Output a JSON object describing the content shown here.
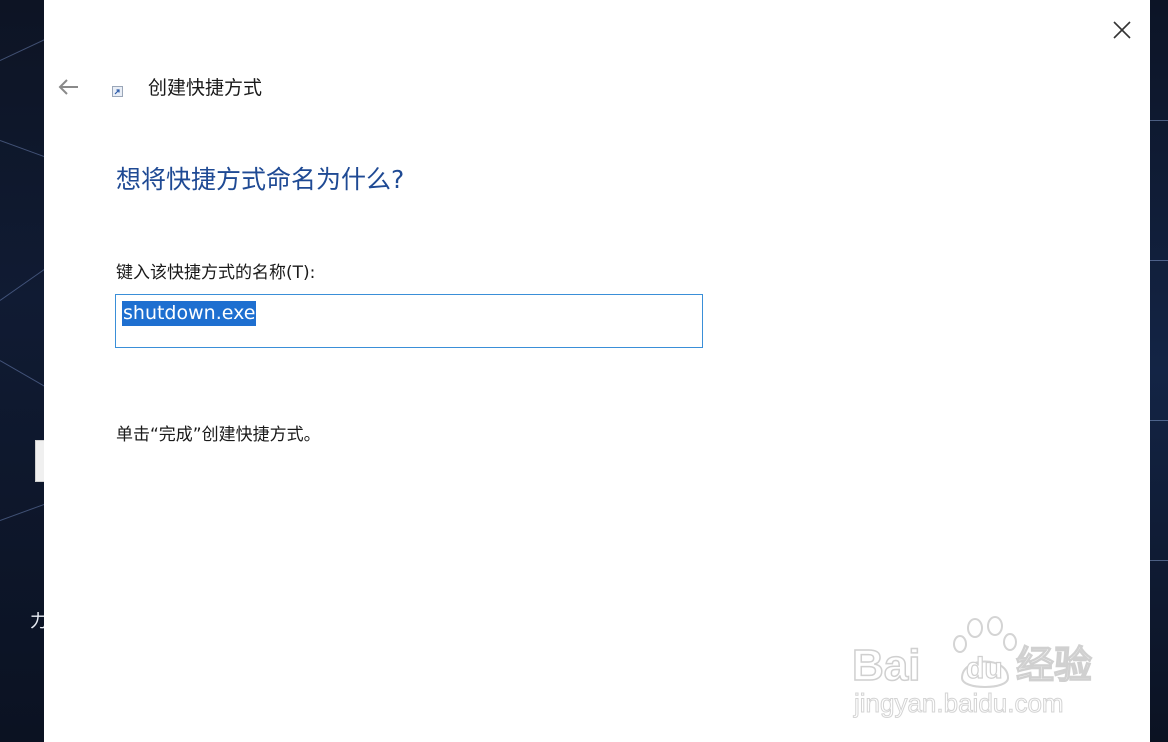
{
  "wizard": {
    "window_title": "创建快捷方式",
    "heading": "想将快捷方式命名为什么?",
    "name_label": "键入该快捷方式的名称(T):",
    "name_value": "shutdown.exe",
    "finish_hint": "单击“完成”创建快捷方式。",
    "back_icon": "back-arrow-icon",
    "close_icon": "close-icon",
    "app_icon": "shortcut-icon"
  },
  "desktop": {
    "partial_text": "力"
  },
  "watermark": {
    "brand_latin": "Bai",
    "brand_du": "du",
    "brand_cn": "经验",
    "url": "jingyan.baidu.com"
  },
  "colors": {
    "heading": "#1f4a94",
    "input_border": "#3a8fd8",
    "selection": "#1e6fd0"
  }
}
